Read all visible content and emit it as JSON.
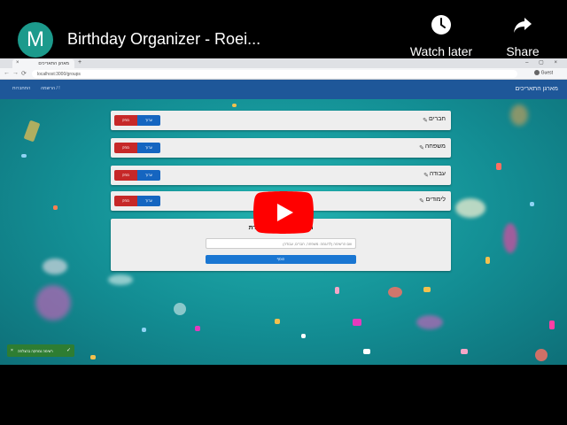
{
  "youtube": {
    "channel_initial": "M",
    "video_title": "Birthday Organizer - Roei...",
    "watch_later_label": "Watch later",
    "share_label": "Share"
  },
  "browser": {
    "tab_title": "מארגן התאריכים",
    "new_tab_symbol": "+",
    "url": "localhost:3000/groups",
    "profile_label": "Guest"
  },
  "app": {
    "title": "מארגן התאריכים",
    "nav": [
      "התחברות",
      "הרשמה / !"
    ]
  },
  "lists": [
    {
      "name": "חברים",
      "delete_label": "מחק",
      "edit_label": "ערוך"
    },
    {
      "name": "משפחה",
      "delete_label": "מחק",
      "edit_label": "ערוך"
    },
    {
      "name": "עבודה",
      "delete_label": "מחק",
      "edit_label": "ערוך"
    },
    {
      "name": "לימודים",
      "delete_label": "מחק",
      "edit_label": "ערוך"
    }
  ],
  "add_form": {
    "title": "הוסף רשימת ימי הולדת",
    "placeholder": "שם הרשימה (לדוגמה: משפחה, חברים, עבודה)",
    "button_label": "הוסף"
  },
  "toast": {
    "text": "רשימה נמחקה בהצלחה",
    "close_symbol": "×",
    "check_symbol": "✓"
  },
  "colors": {
    "youtube_red": "#ff0000",
    "appbar": "#1e5799",
    "delete": "#c62828",
    "edit": "#1565c0",
    "success": "#2e7d32"
  }
}
